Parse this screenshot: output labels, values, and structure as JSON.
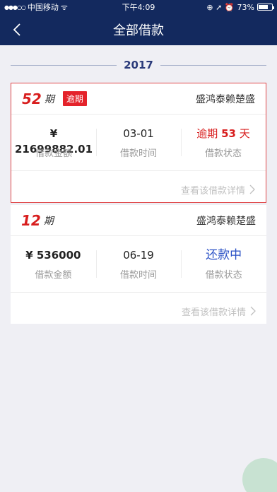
{
  "status_bar": {
    "signal": "●●●○○",
    "carrier": "中国移动",
    "wifi": "ᯤ",
    "time": "下午4:09",
    "icons": "⊕ ➚ ⏰",
    "battery_percent": "73%",
    "battery_level": 0.73
  },
  "nav": {
    "title": "全部借款",
    "back_icon": "chevron-left-icon"
  },
  "year": "2017",
  "loans": [
    {
      "period": "52",
      "period_unit": "期",
      "badge": "逾期",
      "lender": "盛鸿泰赖楚盛",
      "amount": "¥ 21699882.01",
      "amount_label": "借款金额",
      "date": "03-01",
      "date_label": "借款时间",
      "status_prefix": "逾期",
      "status_days": "53",
      "status_suffix": "天",
      "status_label": "借款状态",
      "detail_link": "查看该借款详情"
    },
    {
      "period": "12",
      "period_unit": "期",
      "lender": "盛鸿泰赖楚盛",
      "amount": "¥ 536000",
      "amount_label": "借款金额",
      "date": "06-19",
      "date_label": "借款时间",
      "status": "还款中",
      "status_label": "借款状态",
      "detail_link": "查看该借款详情"
    }
  ],
  "colors": {
    "header_bg": "#13295e",
    "overdue_red": "#d81e1e",
    "repaying_blue": "#2b52c6"
  }
}
